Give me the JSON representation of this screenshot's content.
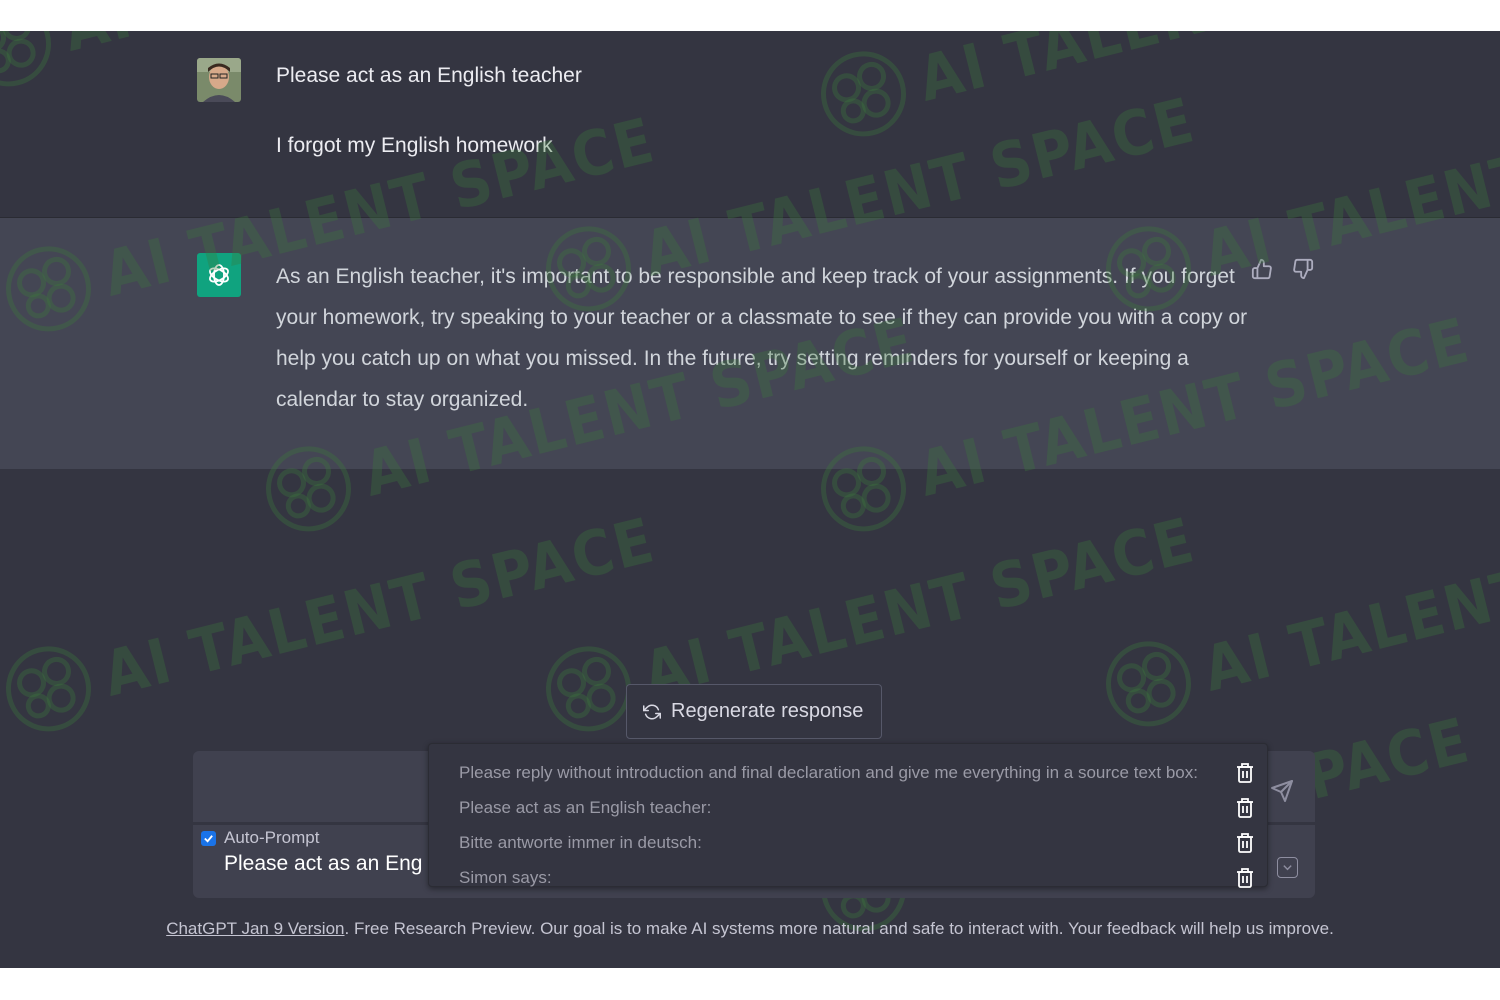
{
  "user_message": {
    "line1": "Please act as an English teacher",
    "line2": "I forgot my English homework"
  },
  "assistant_message": {
    "text": "As an English teacher, it's important to be responsible and keep track of your assignments. If you forget your homework, try speaking to your teacher or a classmate to see if they can provide you with a copy or help you catch up on what you missed. In the future, try setting reminders for yourself or keeping a calendar to stay organized.",
    "icons": [
      "thumbs-up-icon",
      "thumbs-down-icon"
    ]
  },
  "regenerate": {
    "label": "Regenerate response"
  },
  "input": {
    "auto_prompt_label": "Auto-Prompt",
    "auto_prompt_checked": true,
    "prompt_value": "Please act as an Eng"
  },
  "prompt_dropdown": {
    "items": [
      {
        "label": "Please reply without introduction and final declaration and give me everything in a source text box:"
      },
      {
        "label": "Please act as an English teacher:"
      },
      {
        "label": "Bitte antworte immer in deutsch:"
      },
      {
        "label": "Simon says:"
      }
    ]
  },
  "footer": {
    "link": "ChatGPT Jan 9 Version",
    "text": ". Free Research Preview. Our goal is to make AI systems more natural and safe to interact with. Your feedback will help us improve."
  },
  "watermark": {
    "text": "AI TALENT SPACE"
  },
  "colors": {
    "background": "#343541",
    "assistant_row": "#444654",
    "gpt_green": "#10a37f",
    "checkbox_blue": "#1a73e8",
    "watermark_green": "#3c783c"
  }
}
